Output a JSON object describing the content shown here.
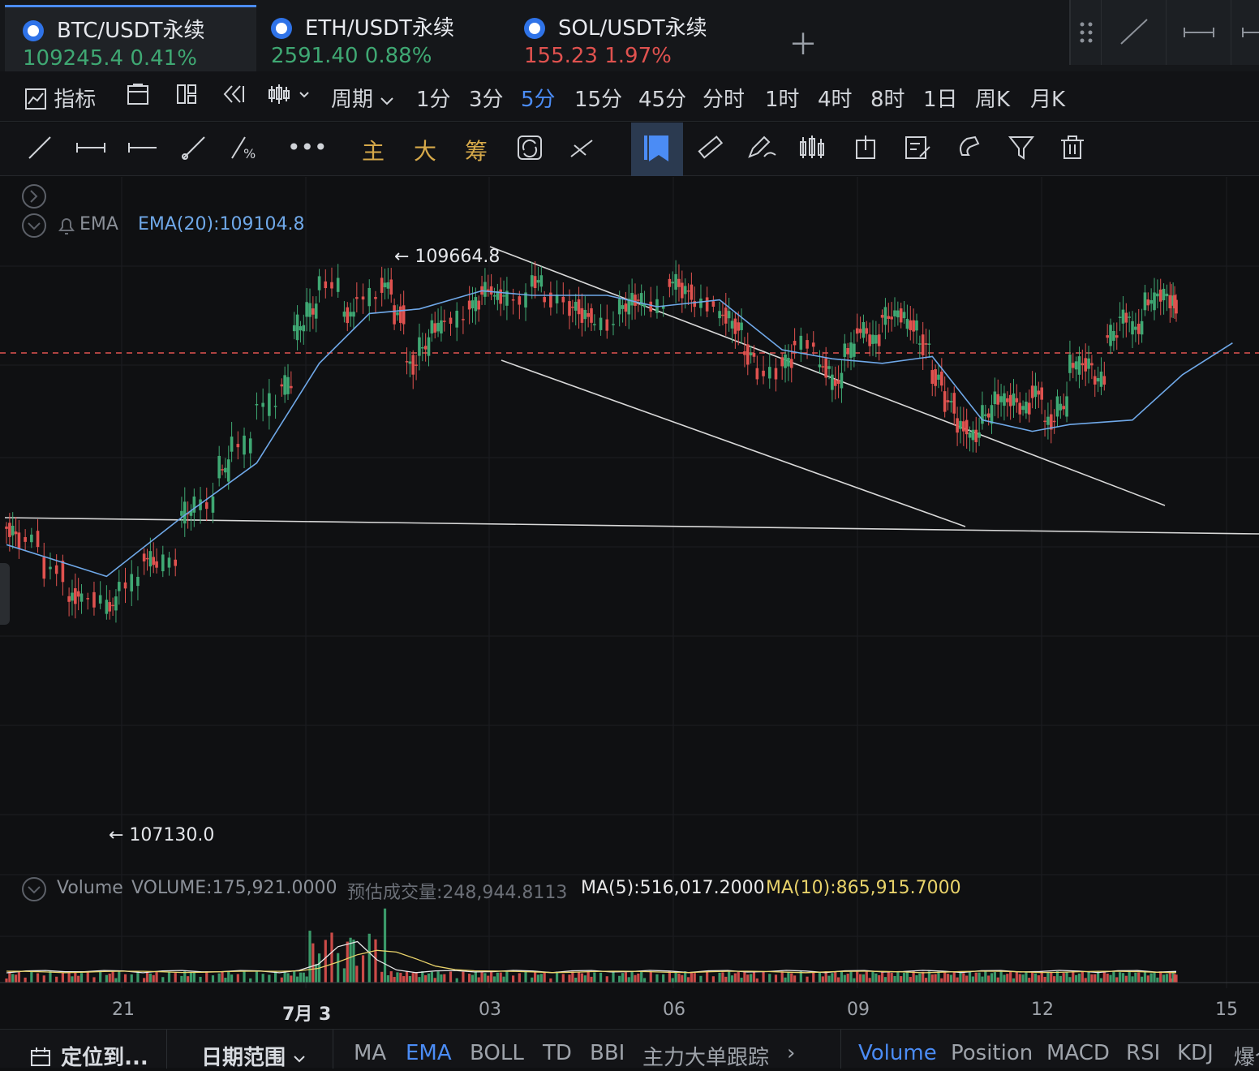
{
  "tabs": [
    {
      "name": "BTC/USDT永续",
      "price": "109245.4",
      "change": "0.41%",
      "color": "green"
    },
    {
      "name": "ETH/USDT永续",
      "price": "2591.40",
      "change": "0.88%",
      "color": "green"
    },
    {
      "name": "SOL/USDT永续",
      "price": "155.23",
      "change": "1.97%",
      "color": "red"
    }
  ],
  "toolbar": {
    "indicator_label": "指标",
    "period_label": "周期",
    "intervals": [
      "1分",
      "3分",
      "5分",
      "15分",
      "45分",
      "分时",
      "1时",
      "4时",
      "8时",
      "1日",
      "周K",
      "月K"
    ],
    "selected_interval": "5分"
  },
  "drawing_tools": {
    "main": "主",
    "large": "大",
    "chips": "筹"
  },
  "chart_legend": {
    "ema_name": "EMA",
    "ema_value": "EMA(20):109104.8",
    "high_label": "← 109664.8",
    "low_label": "← 107130.0",
    "volume_name": "Volume",
    "volume_value": "VOLUME:175,921.0000",
    "est_volume": "预估成交量:248,944.8113",
    "ma5": "MA(5):516,017.2000",
    "ma10": "MA(10):865,915.7000"
  },
  "x_axis_labels": [
    "21",
    "7月 3",
    "03",
    "06",
    "09",
    "12",
    "15"
  ],
  "bottom_bar": {
    "locate": "定位到...",
    "date_range": "日期范围",
    "main_indicators": [
      "MA",
      "EMA",
      "BOLL",
      "TD",
      "BBI",
      "主力大单跟踪"
    ],
    "active_main": "EMA",
    "sub_indicators": [
      "Volume",
      "Position",
      "MACD",
      "RSI",
      "KDJ",
      "爆仓"
    ],
    "active_sub": "Volume"
  },
  "colors": {
    "up": "#3fa873",
    "down": "#e0524f",
    "ema": "#6fa8e8",
    "accent": "#4b8cf5",
    "ma10": "#e8d26a"
  },
  "chart_data": {
    "type": "candlestick",
    "price_high": 109664.8,
    "price_low": 107130.0,
    "last_price": 109245.4,
    "ema20": 109104.8,
    "ema_path": [
      [
        0,
        108400
      ],
      [
        0.08,
        108260
      ],
      [
        0.14,
        108520
      ],
      [
        0.2,
        108760
      ],
      [
        0.25,
        109200
      ],
      [
        0.29,
        109420
      ],
      [
        0.33,
        109440
      ],
      [
        0.38,
        109520
      ],
      [
        0.42,
        109500
      ],
      [
        0.48,
        109500
      ],
      [
        0.52,
        109450
      ],
      [
        0.57,
        109480
      ],
      [
        0.62,
        109260
      ],
      [
        0.66,
        109220
      ],
      [
        0.7,
        109200
      ],
      [
        0.74,
        109230
      ],
      [
        0.78,
        108950
      ],
      [
        0.82,
        108900
      ],
      [
        0.85,
        108930
      ],
      [
        0.9,
        108950
      ],
      [
        0.94,
        109150
      ],
      [
        0.98,
        109290
      ]
    ],
    "candles": [
      [
        0.0,
        108500,
        108480
      ],
      [
        0.01,
        108450,
        108430
      ],
      [
        0.03,
        108440,
        108320
      ],
      [
        0.05,
        108300,
        108170
      ],
      [
        0.06,
        108200,
        108170
      ],
      [
        0.08,
        108160,
        108120
      ],
      [
        0.09,
        108140,
        108200
      ],
      [
        0.11,
        108230,
        108340
      ],
      [
        0.12,
        108320,
        108300
      ],
      [
        0.14,
        108310,
        108520
      ],
      [
        0.15,
        108520,
        108560
      ],
      [
        0.17,
        108560,
        108720
      ],
      [
        0.18,
        108700,
        108820
      ],
      [
        0.2,
        108810,
        109000
      ],
      [
        0.22,
        108990,
        109080
      ],
      [
        0.23,
        109070,
        109330
      ],
      [
        0.24,
        109330,
        109420
      ],
      [
        0.25,
        109410,
        109550
      ],
      [
        0.27,
        109540,
        109420
      ],
      [
        0.28,
        109420,
        109480
      ],
      [
        0.3,
        109480,
        109550
      ],
      [
        0.31,
        109540,
        109440
      ],
      [
        0.32,
        109440,
        109220
      ],
      [
        0.33,
        109200,
        109260
      ],
      [
        0.34,
        109260,
        109350
      ],
      [
        0.35,
        109350,
        109380
      ],
      [
        0.37,
        109390,
        109450
      ],
      [
        0.38,
        109450,
        109520
      ],
      [
        0.39,
        109520,
        109500
      ],
      [
        0.4,
        109500,
        109480
      ],
      [
        0.42,
        109470,
        109560
      ],
      [
        0.43,
        109560,
        109490
      ],
      [
        0.45,
        109490,
        109450
      ],
      [
        0.46,
        109460,
        109420
      ],
      [
        0.47,
        109420,
        109370
      ],
      [
        0.49,
        109370,
        109440
      ],
      [
        0.5,
        109440,
        109480
      ],
      [
        0.51,
        109480,
        109450
      ],
      [
        0.53,
        109440,
        109550
      ],
      [
        0.54,
        109550,
        109530
      ],
      [
        0.55,
        109520,
        109470
      ],
      [
        0.57,
        109470,
        109420
      ],
      [
        0.58,
        109420,
        109380
      ],
      [
        0.59,
        109370,
        109260
      ],
      [
        0.6,
        109250,
        109160
      ],
      [
        0.62,
        109160,
        109200
      ],
      [
        0.63,
        109190,
        109290
      ],
      [
        0.65,
        109280,
        109200
      ],
      [
        0.66,
        109190,
        109110
      ],
      [
        0.67,
        109120,
        109240
      ],
      [
        0.68,
        109240,
        109340
      ],
      [
        0.69,
        109340,
        109300
      ],
      [
        0.7,
        109300,
        109400
      ],
      [
        0.71,
        109390,
        109420
      ],
      [
        0.72,
        109410,
        109380
      ],
      [
        0.73,
        109370,
        109300
      ],
      [
        0.74,
        109300,
        109160
      ],
      [
        0.75,
        109150,
        109050
      ],
      [
        0.76,
        109040,
        108940
      ],
      [
        0.77,
        108930,
        108880
      ],
      [
        0.78,
        108880,
        108960
      ],
      [
        0.79,
        108960,
        109040
      ],
      [
        0.8,
        109030,
        109040
      ],
      [
        0.81,
        109040,
        109000
      ],
      [
        0.82,
        109000,
        109080
      ],
      [
        0.83,
        109070,
        108950
      ],
      [
        0.84,
        108950,
        108990
      ],
      [
        0.85,
        108990,
        109180
      ],
      [
        0.86,
        109170,
        109200
      ],
      [
        0.87,
        109200,
        109120
      ],
      [
        0.88,
        109120,
        109300
      ],
      [
        0.89,
        109300,
        109400
      ],
      [
        0.9,
        109400,
        109350
      ],
      [
        0.91,
        109350,
        109460
      ],
      [
        0.92,
        109460,
        109500
      ],
      [
        0.93,
        109500,
        109480
      ],
      [
        0.935,
        109480,
        109420
      ]
    ],
    "volume": {
      "last": 175921.0,
      "estimated": 248944.8113,
      "ma5": 516017.2,
      "ma10": 865915.7
    }
  }
}
